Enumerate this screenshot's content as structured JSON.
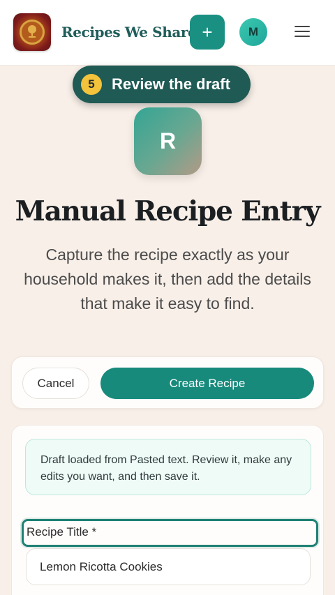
{
  "header": {
    "brand": "Recipes We Share",
    "add_label": "+",
    "avatar_initial": "M"
  },
  "tour": {
    "step_number": "5",
    "step_label": "Review the draft"
  },
  "hero": {
    "badge_letter": "R",
    "title": "Manual Recipe Entry",
    "subtitle": "Capture the recipe exactly as your household makes it, then add the details that make it easy to find."
  },
  "actions": {
    "cancel_label": "Cancel",
    "create_label": "Create Recipe"
  },
  "form": {
    "notice": "Draft loaded from Pasted text. Review it, make any edits you want, and then save it.",
    "title_label": "Recipe Title *",
    "title_value": "Lemon Ricotta Cookies"
  },
  "colors": {
    "accent": "#1a9082",
    "tour_pill": "#1f5a55",
    "step_badge": "#f3c33b",
    "background": "#f8efe8"
  }
}
